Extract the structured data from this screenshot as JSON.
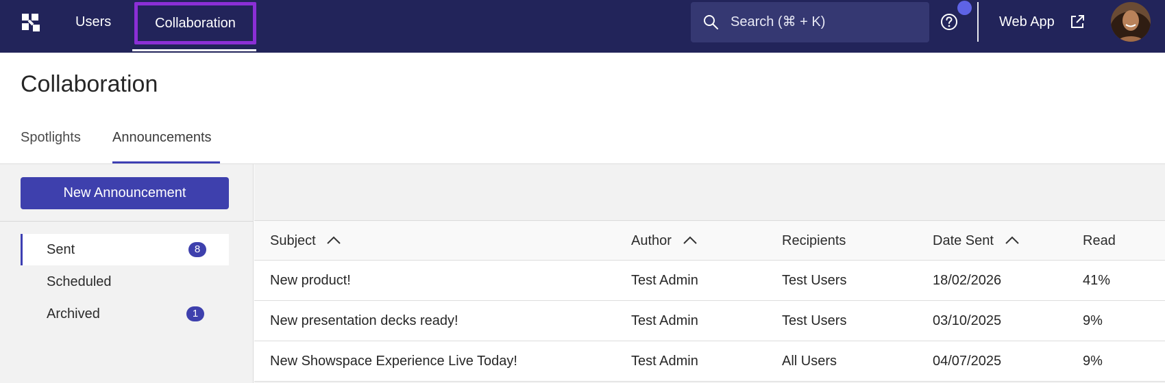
{
  "nav": {
    "items": [
      {
        "label": "Users"
      },
      {
        "label": "Collaboration"
      }
    ],
    "search_placeholder": "Search (⌘ + K)",
    "web_app_label": "Web App"
  },
  "page": {
    "title": "Collaboration",
    "tabs": [
      {
        "label": "Spotlights"
      },
      {
        "label": "Announcements"
      }
    ]
  },
  "sidebar": {
    "new_button_label": "New Announcement",
    "items": [
      {
        "label": "Sent",
        "badge": "8"
      },
      {
        "label": "Scheduled"
      },
      {
        "label": "Archived",
        "badge": "1"
      }
    ]
  },
  "table": {
    "columns": [
      "Subject",
      "Author",
      "Recipients",
      "Date Sent",
      "Read"
    ],
    "rows": [
      [
        "New product!",
        "Test Admin",
        "Test Users",
        "18/02/2026",
        "41%"
      ],
      [
        "New presentation decks ready!",
        "Test Admin",
        "Test Users",
        "03/10/2025",
        "9%"
      ],
      [
        "New Showspace Experience Live Today!",
        "Test Admin",
        "All Users",
        "04/07/2025",
        "9%"
      ]
    ]
  },
  "colors": {
    "nav_background": "#22245a",
    "accent": "#3e40ad",
    "active_nav_outline": "#8b2fd6",
    "notification_dot": "#5e63e6"
  }
}
